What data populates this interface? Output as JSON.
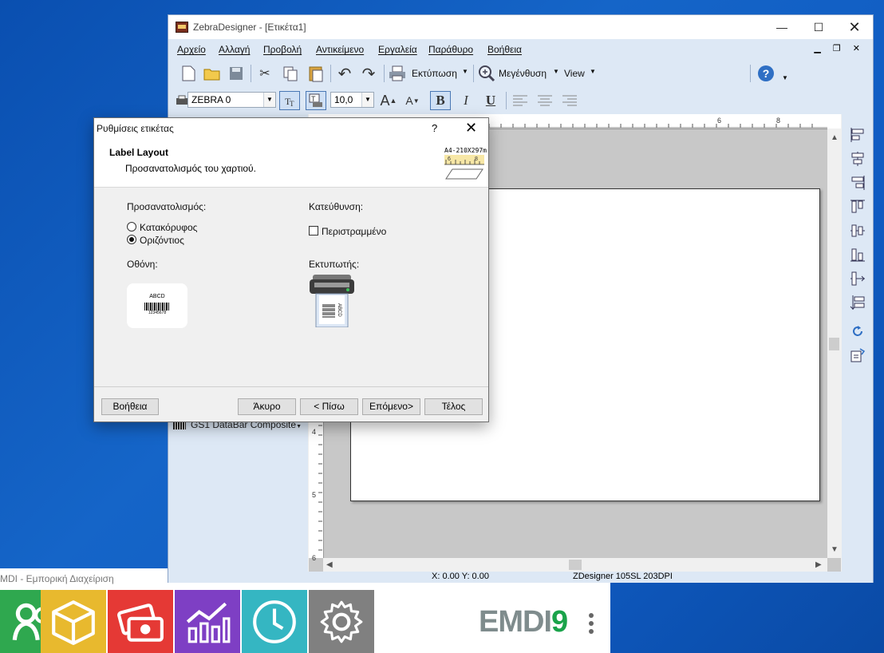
{
  "emdi": {
    "title": "MDI - Εμπορική Διαχείριση",
    "logo_left": "EMDI",
    "logo_right": "9",
    "tiles": [
      {
        "color": "#2fa84f",
        "icon": "people-icon"
      },
      {
        "color": "#e8b92e",
        "icon": "box-icon"
      },
      {
        "color": "#e53935",
        "icon": "money-icon"
      },
      {
        "color": "#7e3fc4",
        "icon": "chart-icon"
      },
      {
        "color": "#35b6c2",
        "icon": "clock-icon"
      },
      {
        "color": "#808080",
        "icon": "gear-icon"
      }
    ]
  },
  "zd": {
    "title": "ZebraDesigner - [Ετικέτα1]",
    "menu": [
      "Αρχείο",
      "Αλλαγή",
      "Προβολή",
      "Αντικείμενο",
      "Εργαλεία",
      "Παράθυρο",
      "Βοήθεια"
    ],
    "print_label": "Εκτύπωση",
    "zoom_label": "Μεγένθυση",
    "view_label": "View",
    "font_combo": "ZEBRA 0",
    "size_combo": "10,0",
    "bold": "B",
    "italic": "I",
    "underline": "U",
    "gs1_item": "GS1 DataBar Composite",
    "ruler_top": [
      "6",
      "8"
    ],
    "ruler_left": [
      "4",
      "5",
      "6"
    ],
    "status_xy": "X:  0.00 Y:  0.00",
    "status_printer": "ZDesigner 105SL 203DPI"
  },
  "dialog": {
    "title": "Ρυθμίσεις ετικέτας",
    "help": "?",
    "heading": "Label Layout",
    "subheading": "Προσανατολισμός του χαρτιού.",
    "size_text": "A4-210X297m",
    "orientation_label": "Προσανατολισμός:",
    "portrait": "Κατακόρυφος",
    "landscape": "Οριζόντιος",
    "selected_orientation": "landscape",
    "direction_label": "Κατεύθυνση:",
    "rotated": "Περιστραμμένο",
    "rotated_checked": false,
    "screen_label": "Οθόνη:",
    "printer_label": "Εκτυπωτής:",
    "preview_text": "ABCD",
    "preview_number": "12345678",
    "buttons": {
      "help": "Βοήθεια",
      "cancel": "Άκυρο",
      "back": "< Πίσω",
      "next": "Επόμενο>",
      "finish": "Τέλος"
    }
  }
}
